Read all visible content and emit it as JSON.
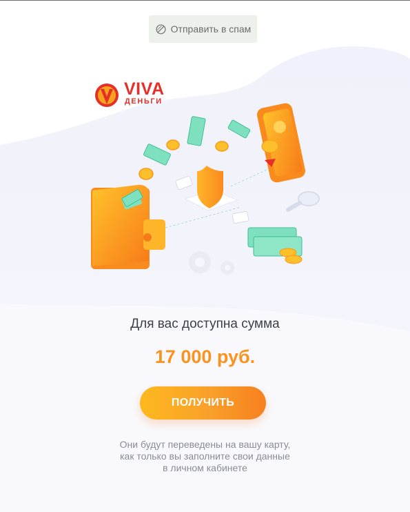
{
  "spam_button": {
    "label": "Отправить в спам",
    "icon": "spam-cancel-icon"
  },
  "logo": {
    "title": "VIVA",
    "subtitle": "ДЕНЬГИ",
    "color": "#e5302a"
  },
  "offer": {
    "headline": "Для вас доступна сумма",
    "amount": "17 000 руб.",
    "cta_label": "ПОЛУЧИТЬ",
    "note_lines": [
      "Они будут переведены на вашу карту,",
      "как только вы заполните свои данные",
      "в личном кабинете"
    ]
  },
  "colors": {
    "accent": "#f7931e",
    "button_gradient_start": "#fdb81e",
    "button_gradient_end": "#f7801e",
    "text_dark": "#3d3f45",
    "text_muted": "#8a8c94"
  }
}
